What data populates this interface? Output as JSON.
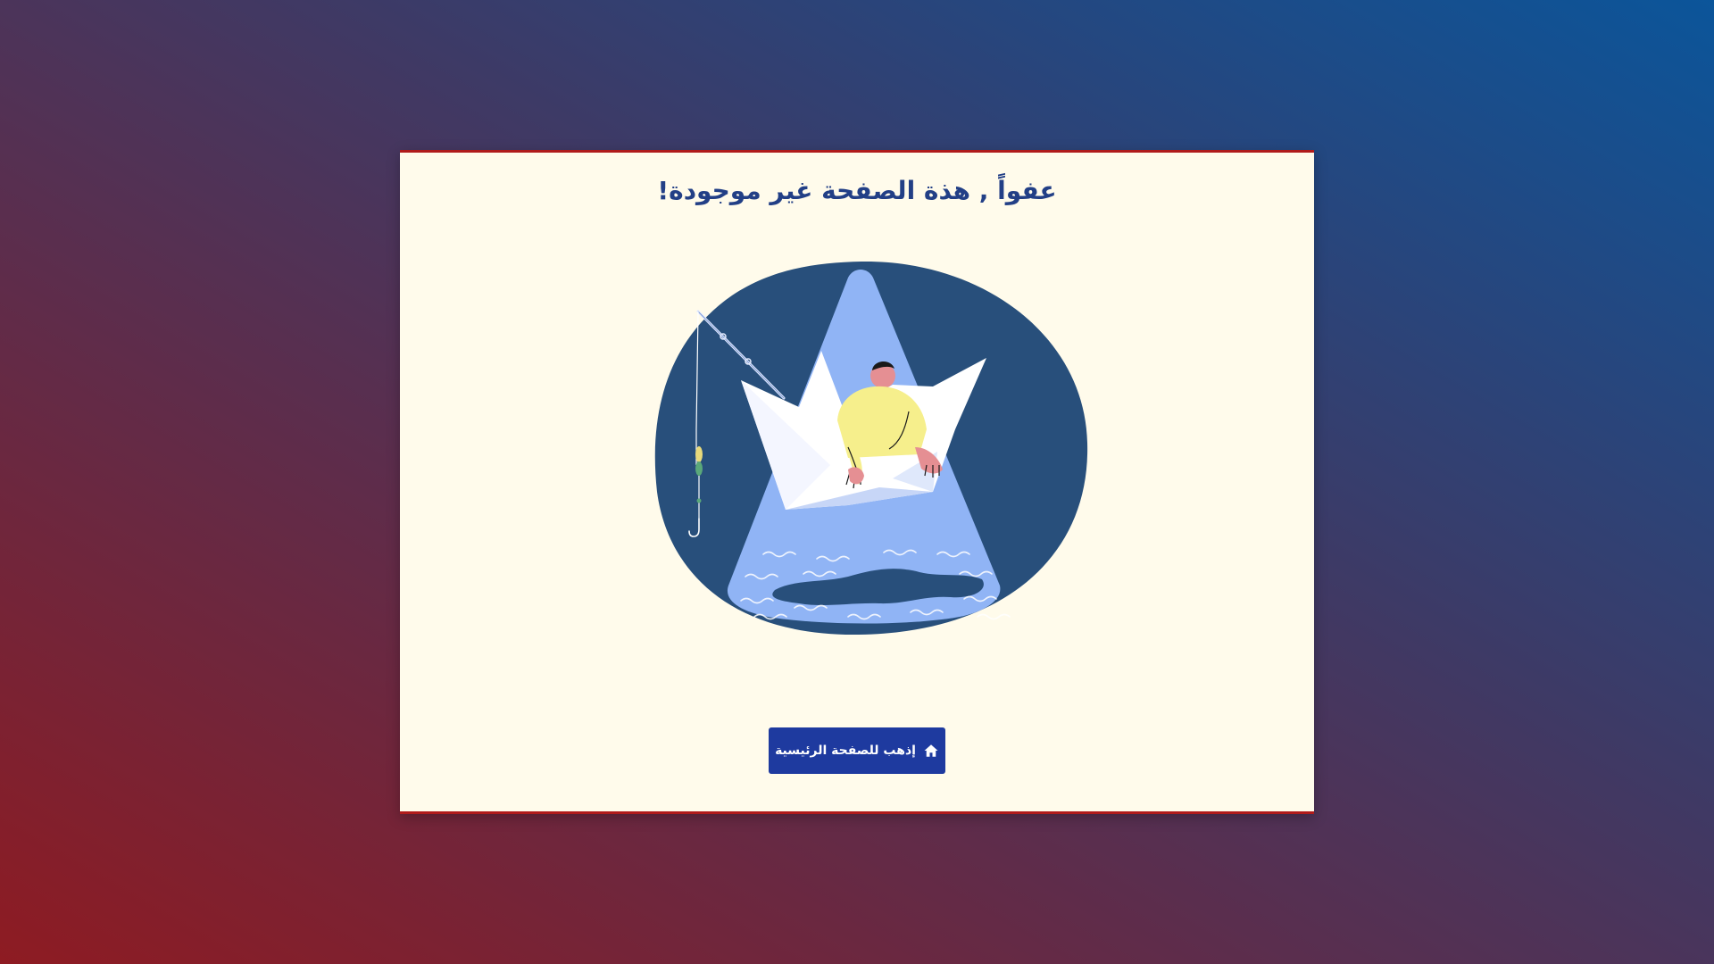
{
  "page": {
    "title": "عفواً , هذة الصفحة غير موجودة!"
  },
  "illustration": {
    "name": "404-boat-fishing-illustration"
  },
  "home_button": {
    "label": "إذهب للصفحة الرئيسية",
    "icon": "home-icon"
  },
  "colors": {
    "card_background": "#fffbeb",
    "card_border": "#b01b1b",
    "title": "#223f86",
    "button": "#1e3a9f",
    "illustration_bg": "#284f7b",
    "light_beam": "#90b4f5"
  }
}
